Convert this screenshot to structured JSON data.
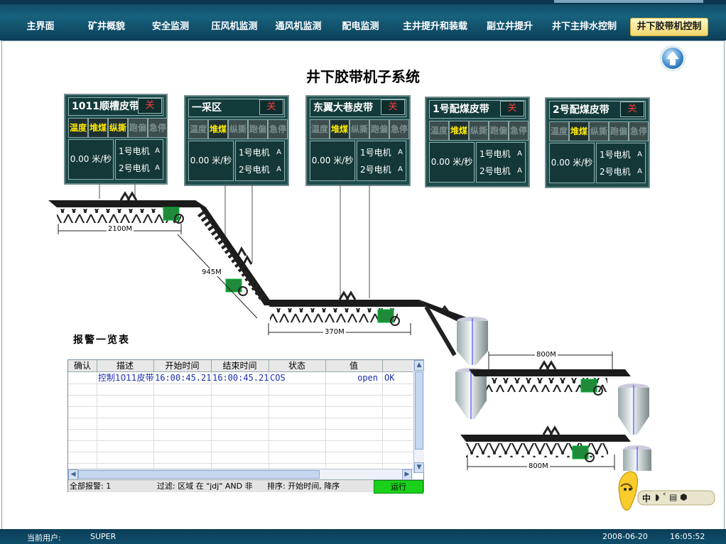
{
  "nav": {
    "tabs": [
      {
        "label": "主界面",
        "x": 0
      },
      {
        "label": "矿井概貌",
        "x": 1
      },
      {
        "label": "安全监测",
        "x": 2
      },
      {
        "label": "压风机监测",
        "x": 3
      },
      {
        "label": "通风机监测",
        "x": 4
      },
      {
        "label": "配电监测",
        "x": 5
      },
      {
        "label": "主井提升和装载",
        "x": 6
      },
      {
        "label": "副立井提升",
        "x": 7
      },
      {
        "label": "井下主排水控制",
        "x": 8
      },
      {
        "label": "井下胶带机控制",
        "x": 9
      }
    ]
  },
  "title": "井下胶带机子系统",
  "panels": [
    {
      "name": "1011顺槽皮带",
      "close": "关",
      "f": [
        "温度",
        "堆煤",
        "纵撕",
        "跑偏",
        "急停"
      ],
      "on": [
        true,
        true,
        true,
        false,
        false
      ],
      "speed": "0.00 米/秒",
      "m1": "1号电机",
      "m2": "2号电机",
      "unit": "A"
    },
    {
      "name": "一采区",
      "close": "关",
      "f": [
        "温度",
        "堆煤",
        "纵撕",
        "跑偏",
        "急停"
      ],
      "on": [
        false,
        true,
        false,
        false,
        false
      ],
      "speed": "0.00 米/秒",
      "m1": "1号电机",
      "m2": "2号电机",
      "unit": "A"
    },
    {
      "name": "东翼大巷皮带",
      "close": "关",
      "f": [
        "温度",
        "堆煤",
        "纵撕",
        "跑偏",
        "急停"
      ],
      "on": [
        false,
        true,
        false,
        false,
        false
      ],
      "speed": "0.00 米/秒",
      "m1": "1号电机",
      "m2": "2号电机",
      "unit": "A"
    },
    {
      "name": "1号配煤皮带",
      "close": "关",
      "f": [
        "温度",
        "堆煤",
        "纵撕",
        "跑偏",
        "急停"
      ],
      "on": [
        false,
        true,
        false,
        false,
        false
      ],
      "speed": "0.00 米/秒",
      "m1": "1号电机",
      "m2": "2号电机",
      "unit": "A"
    },
    {
      "name": "2号配煤皮带",
      "close": "关",
      "f": [
        "温度",
        "堆煤",
        "纵撕",
        "跑偏",
        "急停"
      ],
      "on": [
        false,
        true,
        false,
        false,
        false
      ],
      "speed": "0.00 米/秒",
      "m1": "1号电机",
      "m2": "2号电机",
      "unit": "A"
    }
  ],
  "distances": {
    "d1": "2100M",
    "d2": "945M",
    "d3": "370M",
    "d4": "800M",
    "d5": "800M"
  },
  "alarm": {
    "title": "报警一览表",
    "headers": [
      "确认",
      "描述",
      "开始时间",
      "结束时间",
      "状态",
      "值"
    ],
    "row": {
      "confirm": "",
      "desc": "控制1011皮带",
      "start": "16:00:45.21",
      "end": "16:00:45.21",
      "state": "COS",
      "value": "open",
      "extra": "OK"
    },
    "status_all": "全部报警: 1",
    "status_filter": "过滤: 区域 在 \"jdj\" AND 非",
    "status_sort": "排序: 开始时间, 降序",
    "status_run": "运行"
  },
  "footer": {
    "user_label": "当前用户:",
    "user": "SUPER",
    "date": "2008-06-20",
    "time": "16:05:52"
  },
  "mascot_label": "中"
}
